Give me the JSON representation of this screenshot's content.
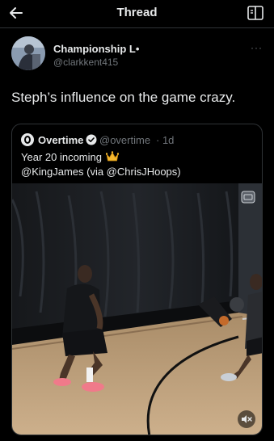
{
  "header": {
    "title": "Thread",
    "back_icon": "arrow-left-icon",
    "reader_icon": "reader-mode-icon"
  },
  "post": {
    "author_name": "Championship L•",
    "author_handle": "@clarkkent415",
    "text": "Steph’s influence on the game crazy.",
    "more_label": "···"
  },
  "quote": {
    "name": "Overtime",
    "handle": "@overtime",
    "time": "· 1d",
    "line1": "Year 20 incoming",
    "line2": "@KingJames (via @ChrisJHoops)",
    "verified_icon": "verified-badge-icon",
    "crown_icon": "crown-emoji-icon"
  },
  "media": {
    "gif_icon": "media-badge-icon",
    "mute_icon": "muted-speaker-icon"
  },
  "colors": {
    "background": "#000000",
    "text_primary": "#e7e9ea",
    "text_secondary": "#71767b",
    "border": "#2f3336",
    "verified": "#1d9bf0"
  }
}
